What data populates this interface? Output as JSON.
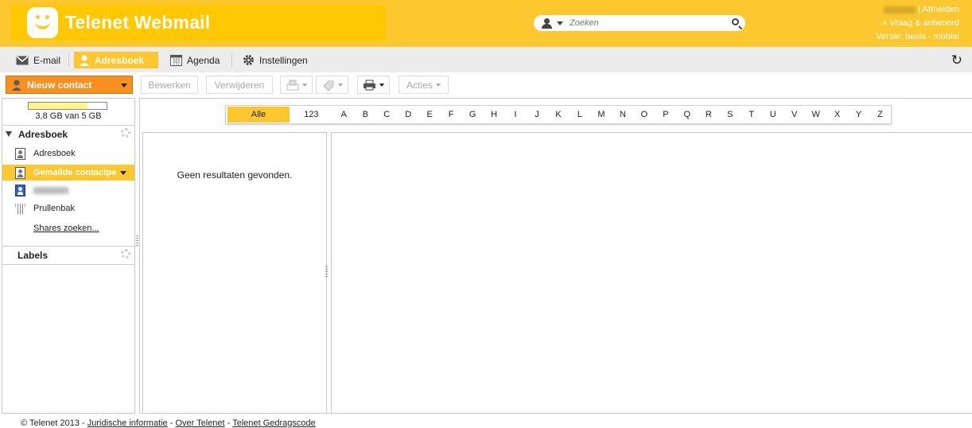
{
  "header": {
    "brand": "Telenet Webmail",
    "search_placeholder": "Zoeken",
    "logout": "Afmelden",
    "help": "» Vraag & antwoord",
    "version": "Versie: basis - mobiel",
    "separator": "|"
  },
  "tabs": [
    {
      "label": "E-mail",
      "icon": "mail-icon"
    },
    {
      "label": "Adresboek",
      "icon": "person-icon"
    },
    {
      "label": "Agenda",
      "icon": "calendar-icon"
    },
    {
      "label": "Instellingen",
      "icon": "gear-icon"
    }
  ],
  "toolbar": {
    "new_contact": "Nieuw contact",
    "edit": "Bewerken",
    "delete": "Verwijderen",
    "actions": "Acties"
  },
  "sidebar": {
    "quota_label": "3,8 GB van 5 GB",
    "quota_used_fraction": 0.76,
    "addressbook_header": "Adresboek",
    "items": [
      {
        "label": "Adresboek"
      },
      {
        "label": "Gemailde contactpe"
      },
      {
        "label": ""
      },
      {
        "label": "Prullenbak"
      },
      {
        "label": "Shares zoeken..."
      }
    ],
    "labels_header": "Labels"
  },
  "alphabet": {
    "all": "Alle",
    "numbers": "123",
    "letters": [
      "A",
      "B",
      "C",
      "D",
      "E",
      "F",
      "G",
      "H",
      "I",
      "J",
      "K",
      "L",
      "M",
      "N",
      "O",
      "P",
      "Q",
      "R",
      "S",
      "T",
      "U",
      "V",
      "W",
      "X",
      "Y",
      "Z"
    ]
  },
  "list": {
    "empty_message": "Geen resultaten gevonden."
  },
  "footer": {
    "copyright": "© Telenet 2013",
    "sep": "-",
    "links": [
      "Juridische informatie",
      "Over Telenet",
      "Telenet Gedragscode"
    ]
  },
  "colors": {
    "brand_yellow": "#fdc82f",
    "accent_orange": "#f7901e"
  }
}
